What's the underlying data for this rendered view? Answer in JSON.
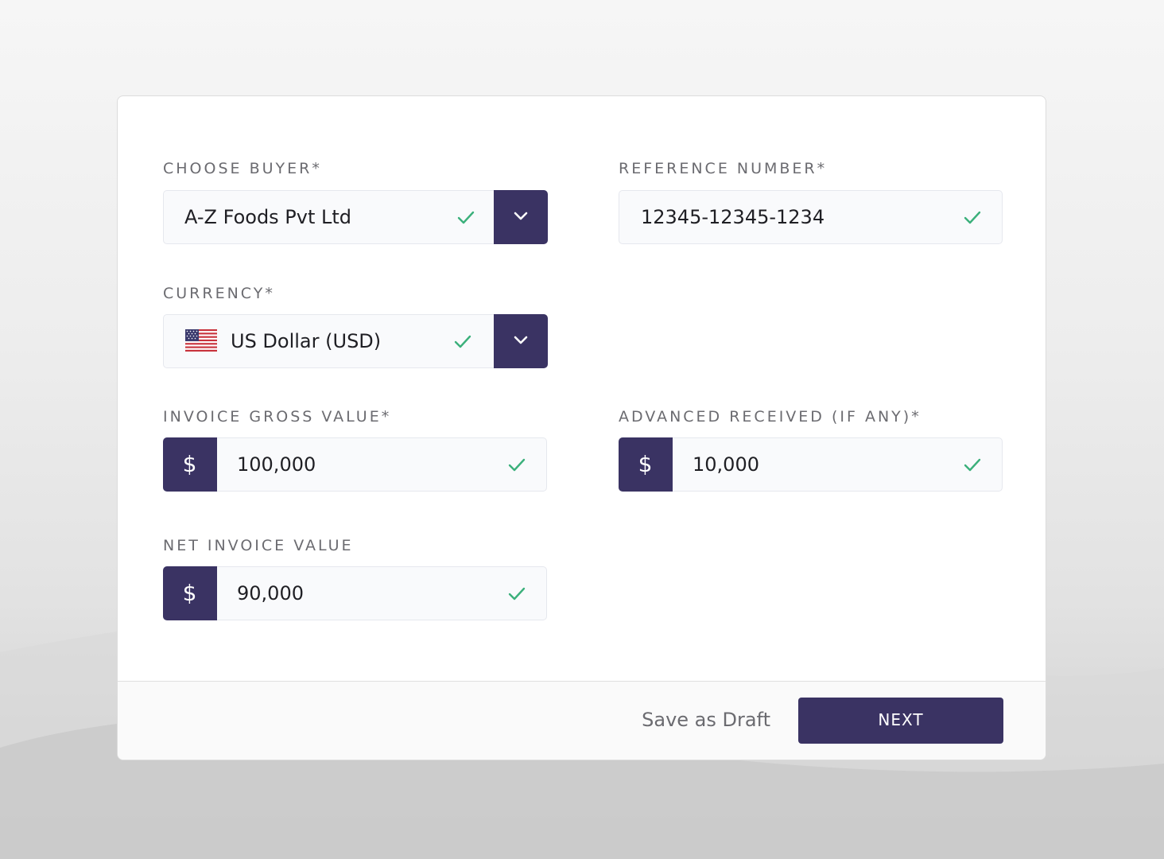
{
  "colors": {
    "accent": "#3a3363",
    "check": "#3bb07b",
    "label": "#6b6b70",
    "field_bg": "#f9fafc"
  },
  "buyer": {
    "label": "CHOOSE BUYER*",
    "value": "A-Z Foods Pvt Ltd",
    "dropdown_icon": "chevron-down-icon",
    "status_icon": "check-icon"
  },
  "reference": {
    "label": "REFERENCE NUMBER*",
    "value": "12345-12345-1234",
    "status_icon": "check-icon"
  },
  "currency": {
    "label": "CURRENCY*",
    "value": "US Dollar (USD)",
    "flag_icon": "us-flag-icon",
    "dropdown_icon": "chevron-down-icon",
    "status_icon": "check-icon"
  },
  "gross_value": {
    "label": "INVOICE GROSS VALUE*",
    "prefix": "$",
    "value": "100,000",
    "status_icon": "check-icon"
  },
  "advance": {
    "label": "ADVANCED RECEIVED (IF ANY)*",
    "prefix": "$",
    "value": "10,000",
    "status_icon": "check-icon"
  },
  "net_value": {
    "label": "NET INVOICE VALUE",
    "prefix": "$",
    "value": "90,000",
    "status_icon": "check-icon"
  },
  "footer": {
    "draft_label": "Save as Draft",
    "next_label": "NEXT"
  }
}
